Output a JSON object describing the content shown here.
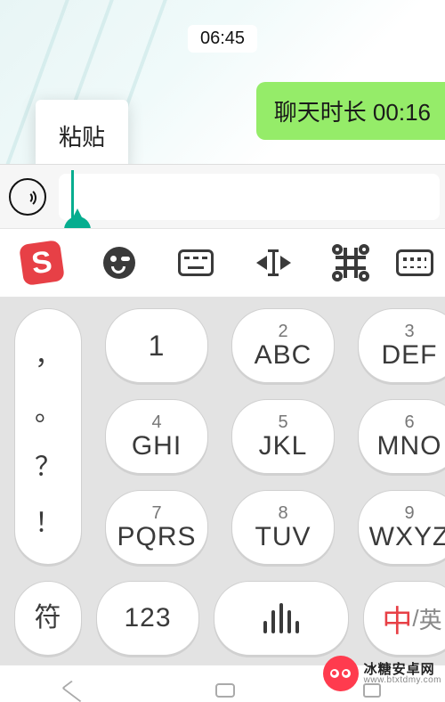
{
  "chat": {
    "timestamp": "06:45",
    "bubble_text": "聊天时长 00:16",
    "paste_label": "粘贴"
  },
  "input": {
    "value": ""
  },
  "ime_toolbar": {
    "logo_letter": "S"
  },
  "keypad": {
    "punct": {
      "p1": "，",
      "p2": "。",
      "p3": "？",
      "p4": "！"
    },
    "k1": {
      "digit": "1",
      "letters": ""
    },
    "k2": {
      "digit": "2",
      "letters": "ABC"
    },
    "k3": {
      "digit": "3",
      "letters": "DEF"
    },
    "k4": {
      "digit": "4",
      "letters": "GHI"
    },
    "k5": {
      "digit": "5",
      "letters": "JKL"
    },
    "k6": {
      "digit": "6",
      "letters": "MNO"
    },
    "k7": {
      "digit": "7",
      "letters": "PQRS"
    },
    "k8": {
      "digit": "8",
      "letters": "TUV"
    },
    "k9": {
      "digit": "9",
      "letters": "WXYZ"
    },
    "sym": "符",
    "num": "123",
    "lang_zh": "中",
    "lang_sep": "/",
    "lang_en": "英"
  },
  "watermark": {
    "line1": "冰糖安卓网",
    "line2": "www.btxtdmy.com"
  }
}
